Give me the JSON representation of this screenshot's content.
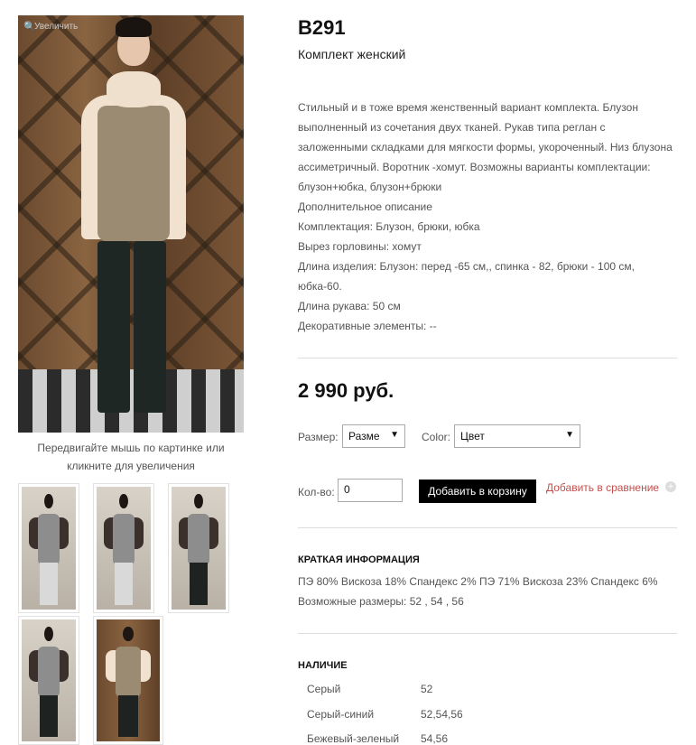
{
  "gallery": {
    "zoom_label": "Увеличить",
    "hint": "Передвигайте мышь по картинке или кликните для увеличения"
  },
  "product": {
    "sku": "B291",
    "subtitle": "Комплект женский",
    "description": [
      "Стильный и в тоже время женственный вариант комплекта. Блузон выполненный из сочетания двух тканей. Рукав типа реглан с заложенными складками для мягкости формы, укороченный. Низ блузона ассиметричный. Воротник -хомут. Возможны варианты комплектации: блузон+юбка, блузон+брюки",
      "Дополнительное описание",
      "Комплектация: Блузон, брюки, юбка",
      "Вырез горловины: хомут",
      "Длина изделия: Блузон: перед -65 см,, спинка - 82, брюки - 100 см, юбка-60.",
      "Длина рукава: 50 см",
      "Декоративные элементы: --"
    ],
    "price": "2 990 руб."
  },
  "options": {
    "size_label": "Размер:",
    "size_value": "Разме",
    "color_label": "Color:",
    "color_value": "Цвет",
    "qty_label": "Кол-во:",
    "qty_value": "0",
    "add_to_cart": "Добавить в корзину",
    "compare": "Добавить в сравнение"
  },
  "short_info": {
    "title": "КРАТКАЯ ИНФОРМАЦИЯ",
    "lines": [
      "ПЭ 80% Вискоза 18% Спандекс 2% ПЭ 71% Вискоза 23% Спандекс 6%",
      "Возможные размеры: 52 , 54 , 56"
    ]
  },
  "availability": {
    "title": "НАЛИЧИЕ",
    "rows": [
      {
        "color": "Серый",
        "sizes": "52"
      },
      {
        "color": "Серый-синий",
        "sizes": "52,54,56"
      },
      {
        "color": "Бежевый-зеленый",
        "sizes": "54,56"
      }
    ]
  }
}
